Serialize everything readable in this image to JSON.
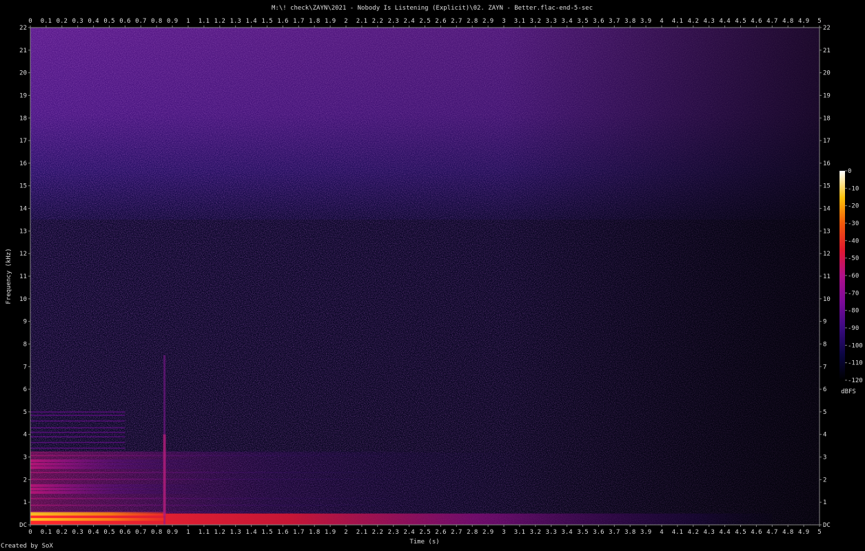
{
  "chart_data": {
    "type": "heatmap",
    "title": "M:\\! check\\ZAYN\\2021 - Nobody Is Listening (Explicit)\\02. ZAYN - Better.flac-end-5-sec",
    "xlabel": "Time (s)",
    "ylabel": "Frequency (kHz)",
    "xlim": [
      0,
      5
    ],
    "ylim": [
      0,
      22
    ],
    "x_ticks": [
      "0",
      "0.1",
      "0.2",
      "0.3",
      "0.4",
      "0.5",
      "0.6",
      "0.7",
      "0.8",
      "0.9",
      "1",
      "1.1",
      "1.2",
      "1.3",
      "1.4",
      "1.5",
      "1.6",
      "1.7",
      "1.8",
      "1.9",
      "2",
      "2.1",
      "2.2",
      "2.3",
      "2.4",
      "2.5",
      "2.6",
      "2.7",
      "2.8",
      "2.9",
      "3",
      "3.1",
      "3.2",
      "3.3",
      "3.4",
      "3.5",
      "3.6",
      "3.7",
      "3.8",
      "3.9",
      "4",
      "4.1",
      "4.2",
      "4.3",
      "4.4",
      "4.5",
      "4.6",
      "4.7",
      "4.8",
      "4.9",
      "5"
    ],
    "y_ticks": [
      "DC",
      "1",
      "2",
      "3",
      "4",
      "5",
      "6",
      "7",
      "8",
      "9",
      "10",
      "11",
      "12",
      "13",
      "14",
      "15",
      "16",
      "17",
      "18",
      "19",
      "20",
      "21",
      "22"
    ],
    "colorbar": {
      "label": "dBFS",
      "range": [
        -120,
        0
      ],
      "ticks": [
        "0",
        "-10",
        "-20",
        "-30",
        "-40",
        "-50",
        "-60",
        "-70",
        "-80",
        "-90",
        "-100",
        "-110",
        "-120"
      ]
    },
    "features": [
      {
        "name": "bass-band",
        "freq_khz": [
          0.0,
          0.5
        ],
        "time_s": [
          0,
          4.7
        ],
        "level_dbfs": -30
      },
      {
        "name": "harmonic-bands",
        "freq_khz": [
          0.5,
          3.2
        ],
        "time_s": [
          0,
          2.0
        ],
        "level_dbfs": -60
      },
      {
        "name": "transient",
        "time_s": 0.85,
        "freq_khz": [
          0,
          7.5
        ],
        "level_dbfs": -80
      },
      {
        "name": "upper-noise-floor",
        "freq_khz": [
          15.5,
          22
        ],
        "time_s": [
          0,
          5
        ],
        "level_dbfs": -95
      }
    ]
  },
  "credit": "Created by SoX"
}
